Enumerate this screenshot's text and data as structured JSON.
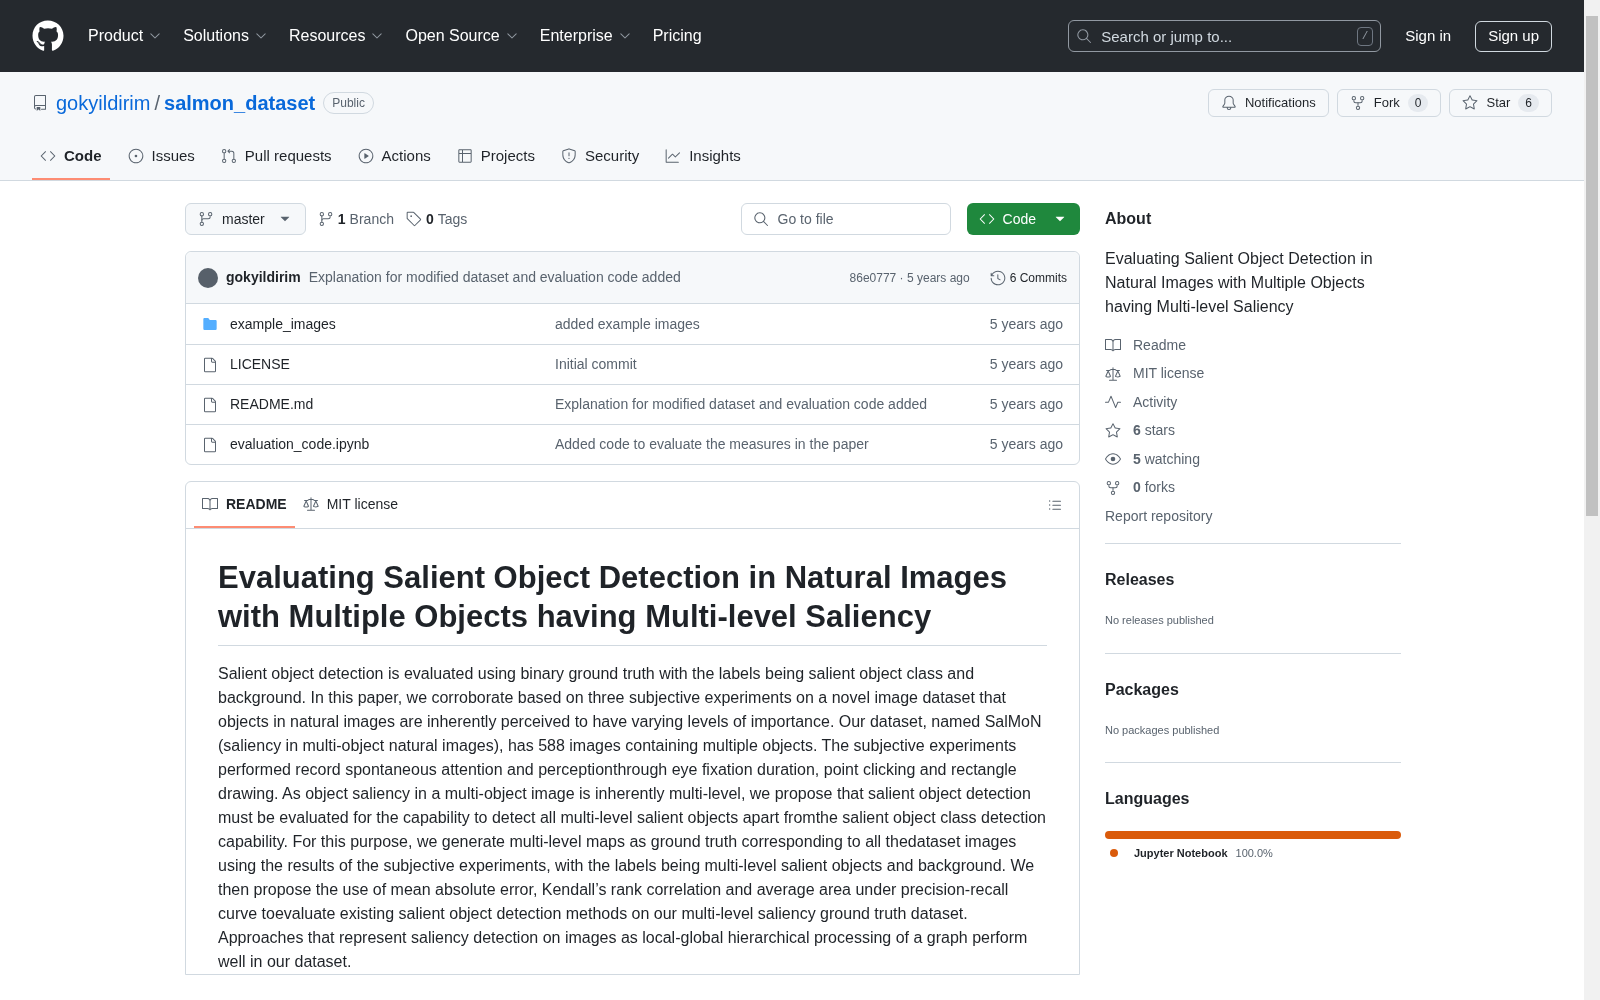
{
  "header": {
    "nav": [
      {
        "label": "Product",
        "menu": true
      },
      {
        "label": "Solutions",
        "menu": true
      },
      {
        "label": "Resources",
        "menu": true
      },
      {
        "label": "Open Source",
        "menu": true
      },
      {
        "label": "Enterprise",
        "menu": true
      },
      {
        "label": "Pricing",
        "menu": false
      }
    ],
    "search": {
      "placeholder": "Search or jump to...",
      "shortcut": "/"
    },
    "sign_in": "Sign in",
    "sign_up": "Sign up"
  },
  "repo": {
    "owner": "gokyildirim",
    "separator": "/",
    "name": "salmon_dataset",
    "visibility": "Public",
    "actions": [
      {
        "label": "Notifications"
      },
      {
        "label": "Fork",
        "count": "0"
      },
      {
        "label": "Star",
        "count": "6"
      }
    ],
    "tabs": [
      {
        "label": "Code",
        "selected": true
      },
      {
        "label": "Issues",
        "selected": false
      },
      {
        "label": "Pull requests",
        "selected": false
      },
      {
        "label": "Actions",
        "selected": false
      },
      {
        "label": "Projects",
        "selected": false
      },
      {
        "label": "Security",
        "selected": false
      },
      {
        "label": "Insights",
        "selected": false
      }
    ]
  },
  "toolbar": {
    "branch": "master",
    "branches_count": "1",
    "branches_label": "Branch",
    "tags_count": "0",
    "tags_label": "Tags",
    "file_search": {
      "placeholder": "Go to file"
    },
    "code_button": "Code"
  },
  "latest_commit": {
    "author": "gokyildirim",
    "message": "Explanation for modified dataset and evaluation code added",
    "meta": "86e0777 · 5 years ago",
    "commits": "6 Commits"
  },
  "files": [
    {
      "kind": "folder",
      "name": "example_images",
      "message": "added example images",
      "time": "5 years ago"
    },
    {
      "kind": "file",
      "name": "LICENSE",
      "message": "Initial commit",
      "time": "5 years ago"
    },
    {
      "kind": "file",
      "name": "README.md",
      "message": "Explanation for modified dataset and evaluation code added",
      "time": "5 years ago"
    },
    {
      "kind": "file",
      "name": "evaluation_code.ipynb",
      "message": "Added code to evaluate the measures in the paper",
      "time": "5 years ago"
    }
  ],
  "readme": {
    "tabs": [
      {
        "label": "README",
        "selected": true
      },
      {
        "label": "MIT license",
        "selected": false
      }
    ],
    "title": "Evaluating Salient Object Detection in Natural Images with Multiple Objects having Multi-level Saliency",
    "body": "Salient object detection is evaluated using binary ground truth with the labels being salient object class and background. In this paper, we corroborate based on three subjective experiments on a novel image dataset that objects in natural images are inherently perceived to have varying levels of importance. Our dataset, named SalMoN (saliency in multi-object natural images), has 588 images containing multiple objects. The subjective experiments performed record spontaneous attention and perceptionthrough eye fixation duration, point clicking and rectangle drawing. As object saliency in a multi-object image is inherently multi-level, we propose that salient object detection must be evaluated for the capability to detect all multi-level salient objects apart fromthe salient object class detection capability. For this purpose, we generate multi-level maps as ground truth corresponding to all thedataset images using the results of the subjective experiments, with the labels being multi-level salient objects and background. We then propose the use of mean absolute error, Kendall’s rank correlation and average area under precision-recall curve toevaluate existing salient object detection methods on our multi-level saliency ground truth dataset. Approaches that represent saliency detection on images as local-global hierarchical processing of a graph perform well in our dataset."
  },
  "about": {
    "heading": "About",
    "description": "Evaluating Salient Object Detection in Natural Images with Multiple Objects having Multi-level Saliency",
    "links": [
      {
        "kind": "readme",
        "label": "Readme"
      },
      {
        "kind": "license",
        "label": "MIT license"
      },
      {
        "kind": "activity",
        "label": "Activity"
      },
      {
        "kind": "stars",
        "count": "6",
        "label": "stars"
      },
      {
        "kind": "watching",
        "count": "5",
        "label": "watching"
      },
      {
        "kind": "forks",
        "count": "0",
        "label": "forks"
      }
    ],
    "report": "Report repository"
  },
  "releases": {
    "heading": "Releases",
    "note": "No releases published"
  },
  "packages": {
    "heading": "Packages",
    "note": "No packages published"
  },
  "languages": {
    "heading": "Languages",
    "items": [
      {
        "name": "Jupyter Notebook",
        "percent": "100.0%",
        "level": 1,
        "color": "#da5b0b"
      }
    ]
  }
}
